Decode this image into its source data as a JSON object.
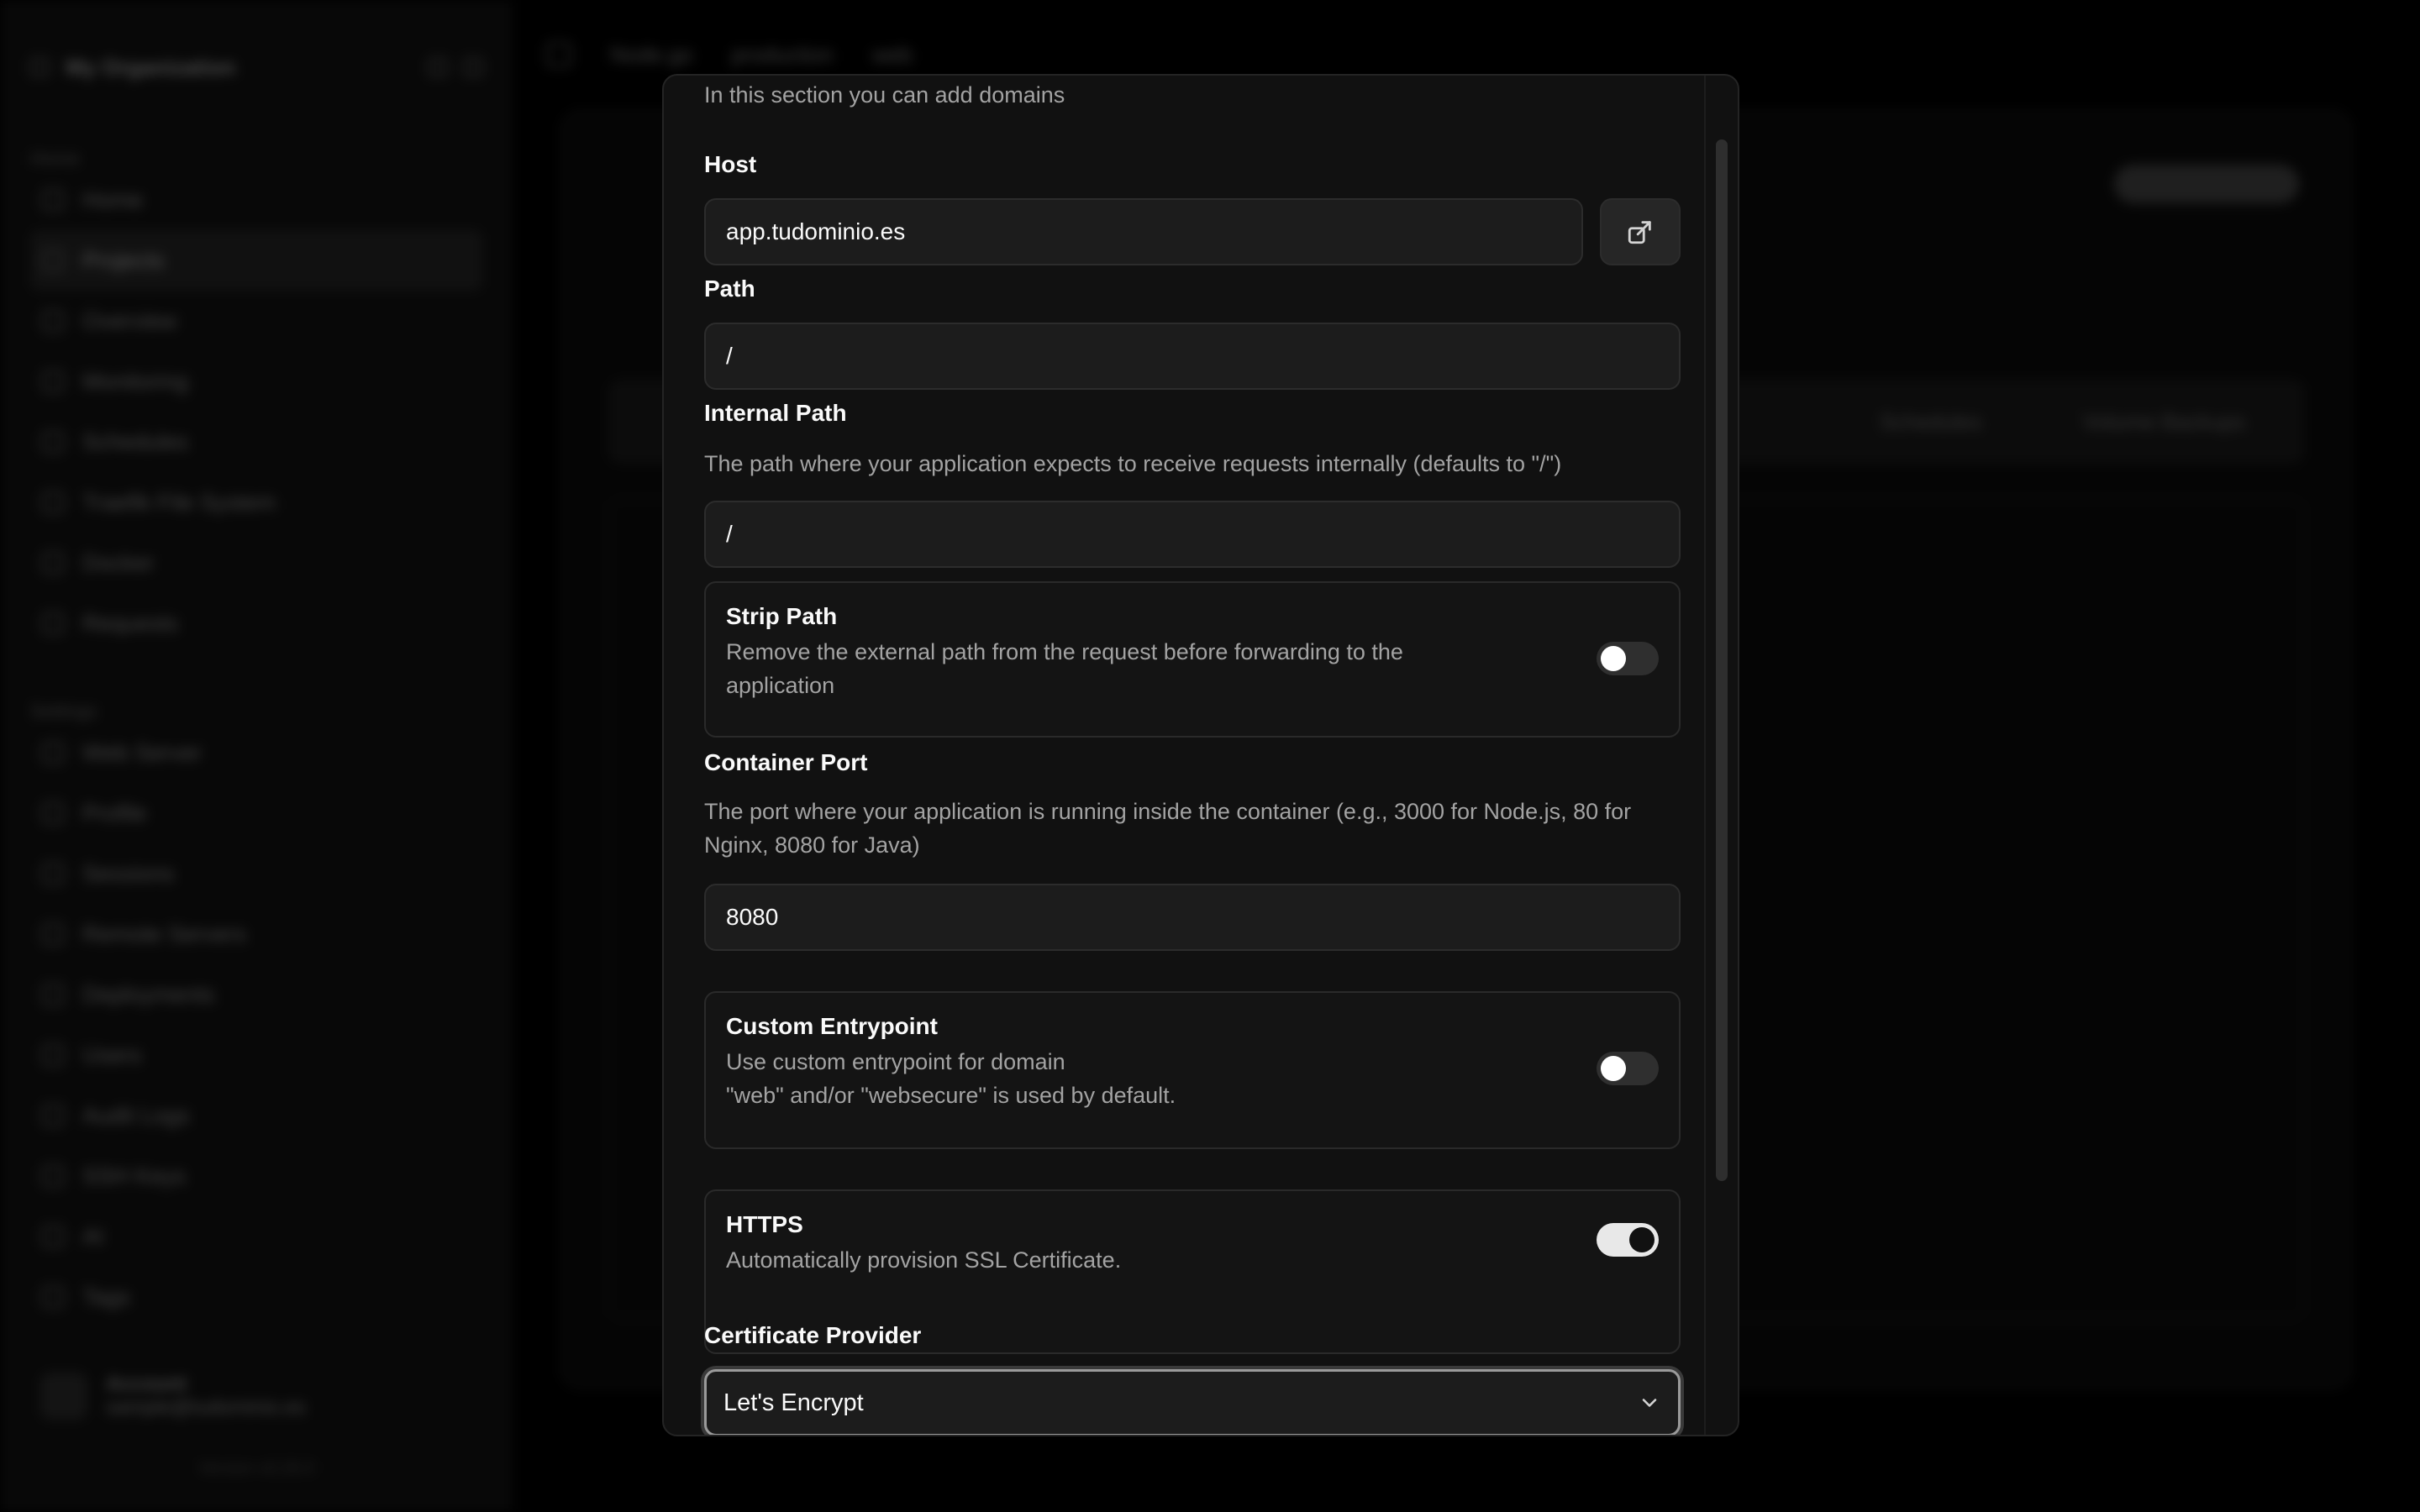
{
  "background": {
    "sidebar": {
      "org_name": "My Organization",
      "group_home": "Home",
      "items_home": [
        "Home",
        "Projects",
        "Overview",
        "Monitoring",
        "Schedules",
        "Traefik File System",
        "Docker",
        "Requests"
      ],
      "group_settings": "Settings",
      "items_settings": [
        "Web Server",
        "Profile",
        "Sessions",
        "Remote Servers",
        "Deployments",
        "Users",
        "Audit Logs",
        "SSH Keys",
        "AI",
        "Tags"
      ],
      "account_name": "Account",
      "account_email": "sample@tudominio.es",
      "version": "Version v0.26.0"
    },
    "topbar": {
      "project": "Node.go",
      "environment": "production",
      "service": "web"
    },
    "tabs": [
      "Schedules",
      "Volume Backups"
    ]
  },
  "dialog": {
    "intro": "In this section you can add domains",
    "host": {
      "label": "Host",
      "value": "app.tudominio.es",
      "action_icon": "external-link-icon"
    },
    "path": {
      "label": "Path",
      "value": "/"
    },
    "internal_path": {
      "label": "Internal Path",
      "description": "The path where your application expects to receive requests internally (defaults to \"/\")",
      "value": "/"
    },
    "strip_path": {
      "title": "Strip Path",
      "description": "Remove the external path from the request before forwarding to the application",
      "enabled": false
    },
    "container_port": {
      "label": "Container Port",
      "description": "The port where your application is running inside the container (e.g., 3000 for Node.js, 80 for Nginx, 8080 for Java)",
      "value": "8080"
    },
    "custom_entrypoint": {
      "title": "Custom Entrypoint",
      "description_line1": "Use custom entrypoint for domain",
      "description_line2": "\"web\" and/or \"websecure\" is used by default.",
      "enabled": false
    },
    "https": {
      "title": "HTTPS",
      "description": "Automatically provision SSL Certificate.",
      "enabled": true
    },
    "certificate_provider": {
      "label": "Certificate Provider",
      "selected": "Let's Encrypt"
    }
  },
  "colors": {
    "dialog_bg": "#111111",
    "input_bg": "#1c1c1c",
    "border": "#2c2c2c",
    "muted_text": "#a3a3a3",
    "switch_on": "#e8e8e8"
  }
}
